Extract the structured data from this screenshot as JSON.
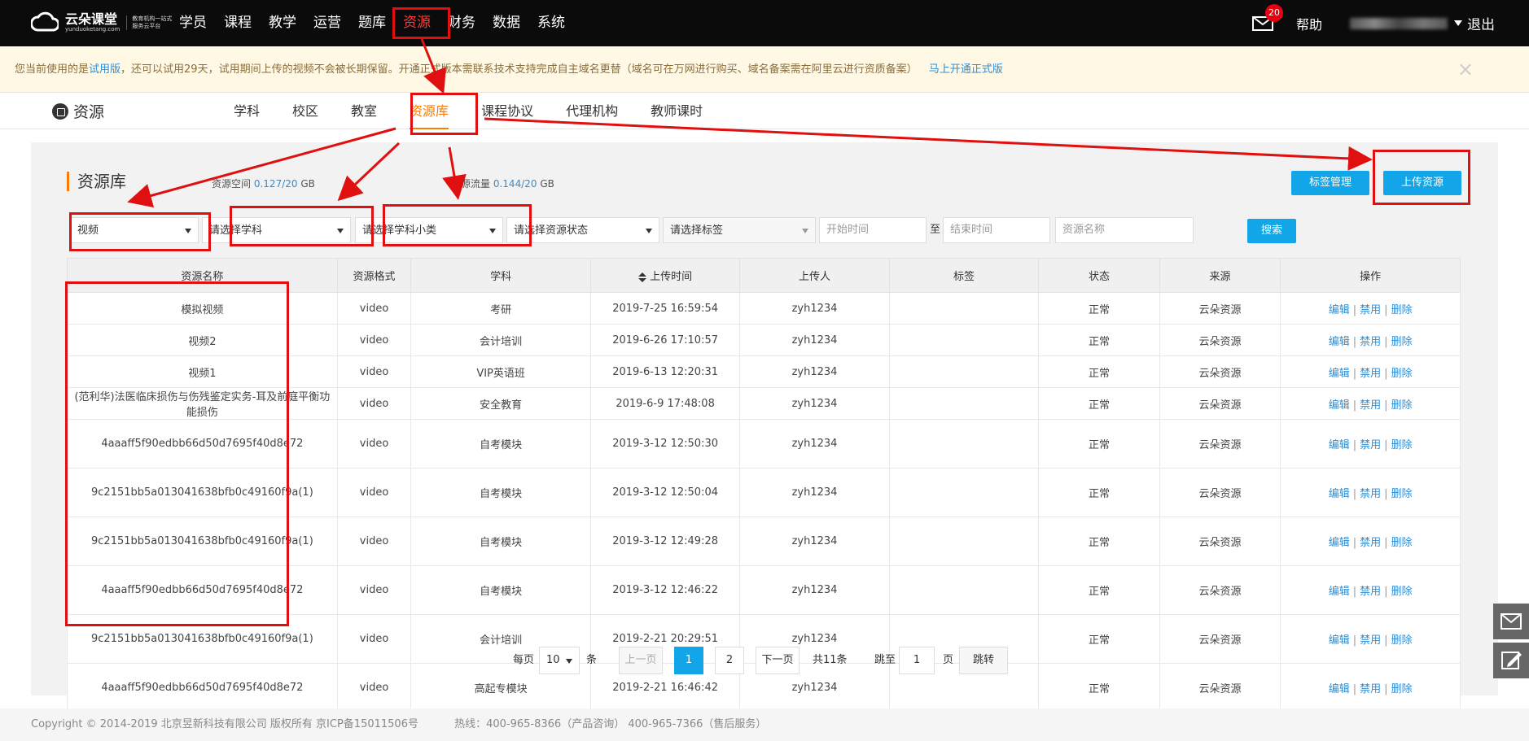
{
  "brand": {
    "name": "云朵课堂",
    "domain": "yunduoketang.com",
    "slogan": "教育机构一站式服务云平台"
  },
  "main_nav": [
    "学员",
    "课程",
    "教学",
    "运营",
    "题库",
    "资源",
    "财务",
    "数据",
    "系统"
  ],
  "active_nav": "资源",
  "notifications_count": "20",
  "help_label": "帮助",
  "logout_label": "退出",
  "notice": {
    "prefix": "您当前使用的是",
    "trial": "试用版",
    "body": "，还可以试用29天，试用期间上传的视频不会被长期保留。开通正式版本需联系技术支持完成自主域名更替（域名可在万网进行购买、域名备案需在阿里云进行资质备案）",
    "link": "马上开通正式版",
    "close": "×"
  },
  "section_title": "资源",
  "sub_tabs": [
    "学科",
    "校区",
    "教室",
    "资源库",
    "课程协议",
    "代理机构",
    "教师课时"
  ],
  "active_tab": "资源库",
  "panel": {
    "title": "资源库",
    "space_label": "资源空间",
    "space_value": "0.127/20",
    "space_unit": "GB",
    "traffic_label": "资源流量",
    "traffic_value": "0.144/20",
    "traffic_unit": "GB",
    "tag_manage": "标签管理",
    "upload": "上传资源"
  },
  "filters": {
    "type": "视频",
    "subject": "请选择学科",
    "subcategory": "请选择学科小类",
    "status": "请选择资源状态",
    "tag": "请选择标签",
    "start_placeholder": "开始时间",
    "to": "至",
    "end_placeholder": "结束时间",
    "name_placeholder": "资源名称",
    "search": "搜索"
  },
  "columns": [
    "资源名称",
    "资源格式",
    "学科",
    "上传时间",
    "上传人",
    "标签",
    "状态",
    "来源",
    "操作"
  ],
  "rows": [
    {
      "name": "模拟视频",
      "format": "video",
      "subject": "考研",
      "time": "2019-7-25 16:59:54",
      "uploader": "zyh1234",
      "tag": "",
      "status": "正常",
      "source": "云朵资源"
    },
    {
      "name": "视频2",
      "format": "video",
      "subject": "会计培训",
      "time": "2019-6-26 17:10:57",
      "uploader": "zyh1234",
      "tag": "",
      "status": "正常",
      "source": "云朵资源"
    },
    {
      "name": "视频1",
      "format": "video",
      "subject": "VIP英语班",
      "time": "2019-6-13 12:20:31",
      "uploader": "zyh1234",
      "tag": "",
      "status": "正常",
      "source": "云朵资源"
    },
    {
      "name": "(范利华)法医临床损伤与伤残鉴定实务-耳及前庭平衡功能损伤",
      "format": "video",
      "subject": "安全教育",
      "time": "2019-6-9 17:48:08",
      "uploader": "zyh1234",
      "tag": "",
      "status": "正常",
      "source": "云朵资源"
    },
    {
      "name": "4aaaff5f90edbb66d50d7695f40d8e72",
      "format": "video",
      "subject": "自考模块",
      "time": "2019-3-12 12:50:30",
      "uploader": "zyh1234",
      "tag": "",
      "status": "正常",
      "source": "云朵资源"
    },
    {
      "name": "9c2151bb5a013041638bfb0c49160f9a(1)",
      "format": "video",
      "subject": "自考模块",
      "time": "2019-3-12 12:50:04",
      "uploader": "zyh1234",
      "tag": "",
      "status": "正常",
      "source": "云朵资源"
    },
    {
      "name": "9c2151bb5a013041638bfb0c49160f9a(1)",
      "format": "video",
      "subject": "自考模块",
      "time": "2019-3-12 12:49:28",
      "uploader": "zyh1234",
      "tag": "",
      "status": "正常",
      "source": "云朵资源"
    },
    {
      "name": "4aaaff5f90edbb66d50d7695f40d8e72",
      "format": "video",
      "subject": "自考模块",
      "time": "2019-3-12 12:46:22",
      "uploader": "zyh1234",
      "tag": "",
      "status": "正常",
      "source": "云朵资源"
    },
    {
      "name": "9c2151bb5a013041638bfb0c49160f9a(1)",
      "format": "video",
      "subject": "会计培训",
      "time": "2019-2-21 20:29:51",
      "uploader": "zyh1234",
      "tag": "",
      "status": "正常",
      "source": "云朵资源"
    },
    {
      "name": "4aaaff5f90edbb66d50d7695f40d8e72",
      "format": "video",
      "subject": "高起专模块",
      "time": "2019-2-21 16:46:42",
      "uploader": "zyh1234",
      "tag": "",
      "status": "正常",
      "source": "云朵资源"
    }
  ],
  "row_actions": {
    "edit": "编辑",
    "disable": "禁用",
    "delete": "删除",
    "sep": "|"
  },
  "pager": {
    "per_page_label": "每页",
    "per_page": "10",
    "unit": "条",
    "prev": "上一页",
    "pages": [
      "1",
      "2"
    ],
    "current": "1",
    "next": "下一页",
    "total": "共11条",
    "goto_label": "跳至",
    "goto_value": "1",
    "page_unit": "页",
    "goto_button": "跳转"
  },
  "footer": {
    "copyright": "Copyright © 2014-2019 北京昱新科技有限公司 版权所有 京ICP备15011506号",
    "hotline": "热线：400-965-8366（产品咨询） 400-965-7366（售后服务）"
  },
  "colors": {
    "accent": "#ff7a00",
    "link": "#2d8ed6",
    "button": "#12a6e8",
    "annotation": "#e01010"
  }
}
